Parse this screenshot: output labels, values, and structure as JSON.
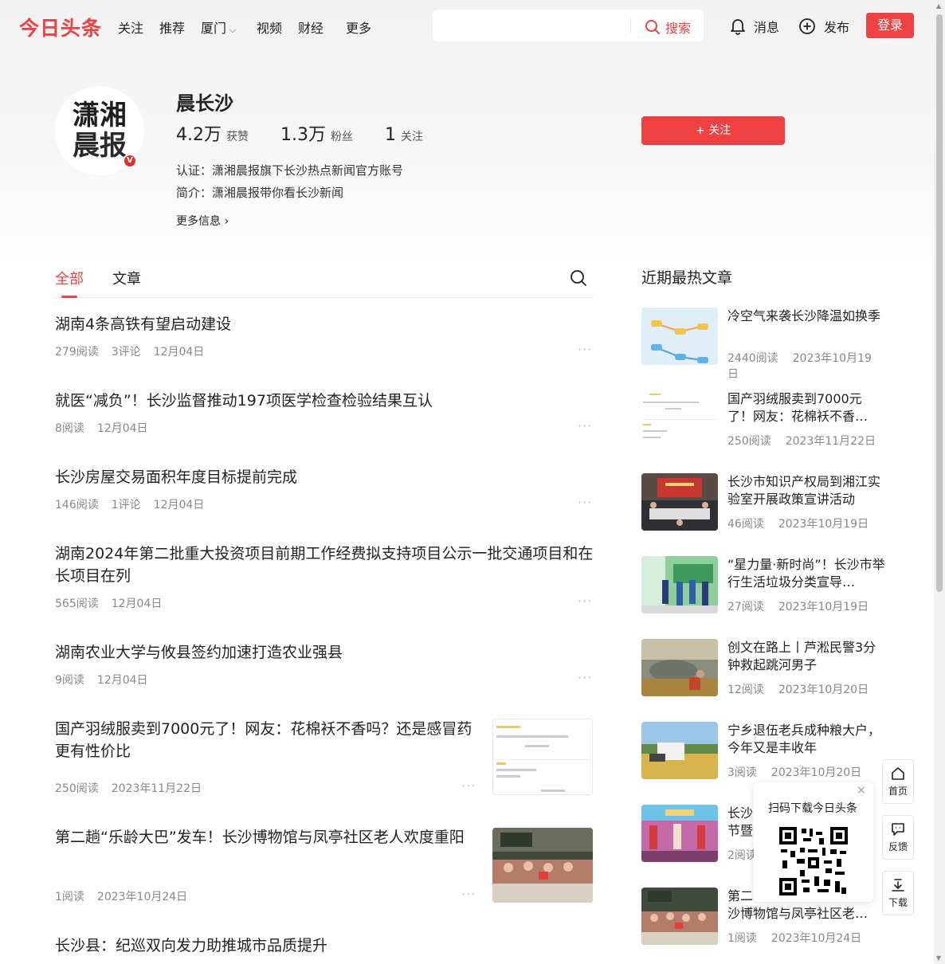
{
  "topnav": {
    "logo": "今日头条",
    "items": [
      "关注",
      "推荐",
      "厦门",
      "视频",
      "财经",
      "更多"
    ],
    "search_placeholder": "",
    "search_label": "搜索",
    "messages_label": "消息",
    "publish_label": "发布",
    "login_label": "登录"
  },
  "profile": {
    "avatar_line1": "潇湘",
    "avatar_line2": "晨报",
    "badge": "V",
    "name": "晨长沙",
    "likes_num": "4.2万",
    "likes_label": "获赞",
    "fans_num": "1.3万",
    "fans_label": "粉丝",
    "following_num": "1",
    "following_label": "关注",
    "follow_button": "+ 关注",
    "cert": "认证：潇湘晨报旗下长沙热点新闻官方账号",
    "intro": "简介：潇湘晨报带你看长沙新闻",
    "more_info": "更多信息 ›"
  },
  "feed": {
    "tabs": [
      "全部",
      "文章"
    ],
    "articles": [
      {
        "title": "湖南4条高铁有望启动建设",
        "reads": "279阅读",
        "comments": "3评论",
        "date": "12月04日"
      },
      {
        "title": "就医“减负”！长沙监督推动197项医学检查检验结果互认",
        "reads": "8阅读",
        "comments": "",
        "date": "12月04日"
      },
      {
        "title": "长沙房屋交易面积年度目标提前完成",
        "reads": "146阅读",
        "comments": "1评论",
        "date": "12月04日"
      },
      {
        "title": "湖南2024年第二批重大投资项目前期工作经费拟支持项目公示一批交通项目和在长项目在列",
        "reads": "565阅读",
        "comments": "",
        "date": "12月04日"
      },
      {
        "title": "湖南农业大学与攸县签约加速打造农业强县",
        "reads": "9阅读",
        "comments": "",
        "date": "12月04日"
      },
      {
        "title": "国产羽绒服卖到7000元了！网友：花棉袄不香吗？还是感冒药更有性价比",
        "reads": "250阅读",
        "comments": "",
        "date": "2023年11月22日"
      },
      {
        "title": "第二趟“乐龄大巴”发车！长沙博物馆与凤亭社区老人欢度重阳",
        "reads": "1阅读",
        "comments": "",
        "date": "2023年10月24日"
      },
      {
        "title": "长沙县：纪巡双向发力助推城市品质提升",
        "reads": "",
        "comments": "",
        "date": ""
      }
    ]
  },
  "sidebar": {
    "title": "近期最热文章",
    "items": [
      {
        "title": "冷空气来袭长沙降温如换季",
        "reads": "2440阅读",
        "date": "2023年10月19日"
      },
      {
        "title": "国产羽绒服卖到7000元了！网友：花棉袄不香…",
        "reads": "250阅读",
        "date": "2023年11月22日"
      },
      {
        "title": "长沙市知识产权局到湘江实验室开展政策宣讲活动",
        "reads": "46阅读",
        "date": "2023年10月19日"
      },
      {
        "title": "“星力量·新时尚”！长沙市举行生活垃圾分类宣导…",
        "reads": "27阅读",
        "date": "2023年10月19日"
      },
      {
        "title": "创文在路上丨芦淞民警3分钟救起跳河男子",
        "reads": "12阅读",
        "date": "2023年10月20日"
      },
      {
        "title": "宁乡退伍老兵成种粮大户，今年又是丰收年",
        "reads": "3阅读",
        "date": "2023年10月20日"
      },
      {
        "title": "长沙",
        "title2": "节暨",
        "reads": "2阅读",
        "date": ""
      },
      {
        "title": "第二",
        "title2": "沙博物馆与凤亭社区老…",
        "reads": "1阅读",
        "date": "2023年10月24日"
      }
    ]
  },
  "widgets": {
    "qr_text": "扫码下载今日头条",
    "close": "×",
    "home_label": "首页",
    "feedback_label": "反馈",
    "download_label": "下载"
  },
  "colors": {
    "accent": "#f04142"
  }
}
